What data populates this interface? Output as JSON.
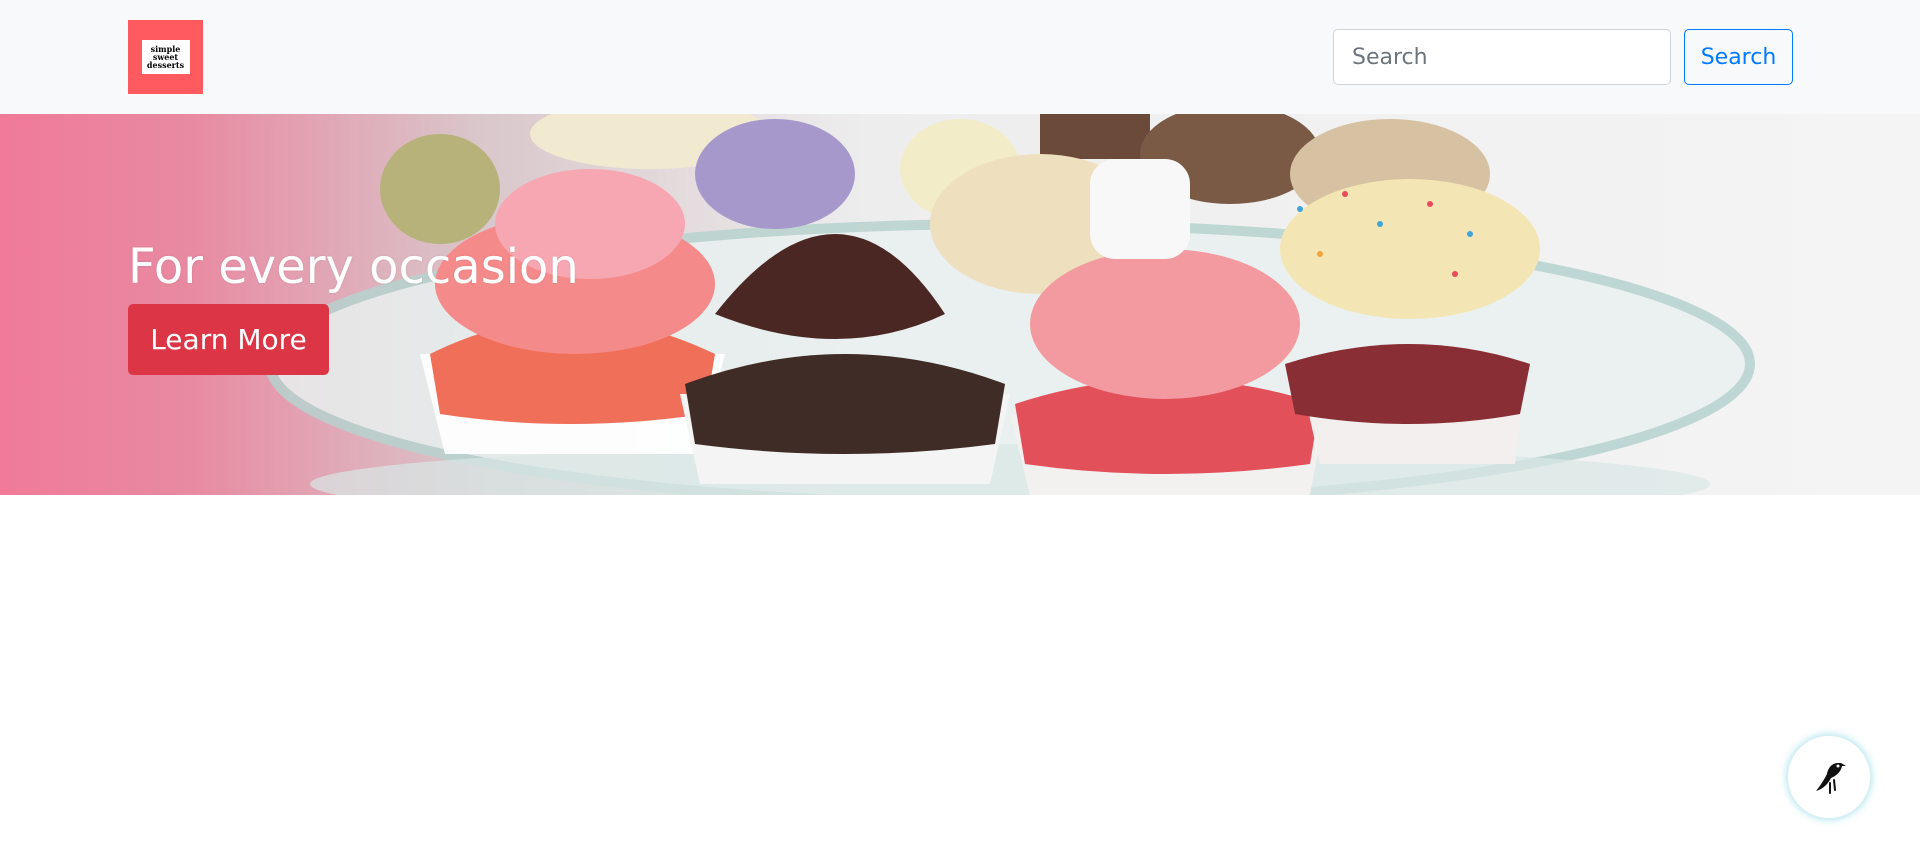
{
  "navbar": {
    "logo": {
      "lines": [
        "simple",
        "sweet",
        "desserts"
      ],
      "color": "#ff5a5f"
    },
    "search": {
      "placeholder": "Search",
      "value": "",
      "button_label": "Search"
    }
  },
  "hero": {
    "title": "For every occasion",
    "button_label": "Learn More",
    "button_color": "#dc3545",
    "image": "cupcakes-on-glass-plate"
  },
  "fab": {
    "icon": "bird-icon"
  },
  "colors": {
    "navbar_bg": "#f8f9fa",
    "accent_blue": "#007bff",
    "accent_red": "#dc3545"
  }
}
